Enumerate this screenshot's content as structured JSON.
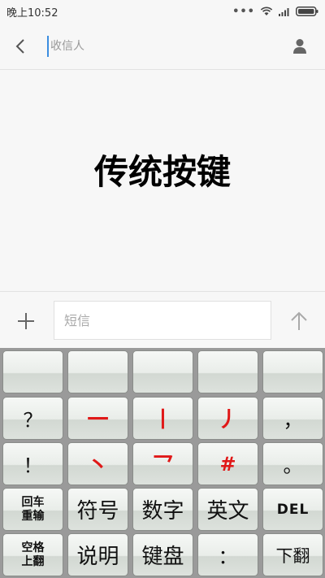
{
  "status_bar": {
    "time": "晚上10:52",
    "dots": "•••"
  },
  "top_bar": {
    "recipient_placeholder": "收信人"
  },
  "main": {
    "title": "传统按键"
  },
  "compose": {
    "placeholder": "短信"
  },
  "keyboard": {
    "row1": [
      "",
      "",
      "",
      "",
      ""
    ],
    "row2": [
      "？",
      "一",
      "丨",
      "丿",
      "，"
    ],
    "row3": [
      "！",
      "丶",
      "乛",
      "#",
      "。"
    ],
    "row4": {
      "enter_line1": "回车",
      "enter_line2": "重输",
      "symbols": "符号",
      "numbers": "数字",
      "english": "英文",
      "del": "DEL"
    },
    "row5": {
      "space_line1": "空格",
      "space_line2": "上翻",
      "help": "说明",
      "keyboard": "键盘",
      "colon": "：",
      "page_down": "下翻"
    }
  },
  "colors": {
    "stroke_keys": "#e01818",
    "accent": "#3b8de0"
  }
}
